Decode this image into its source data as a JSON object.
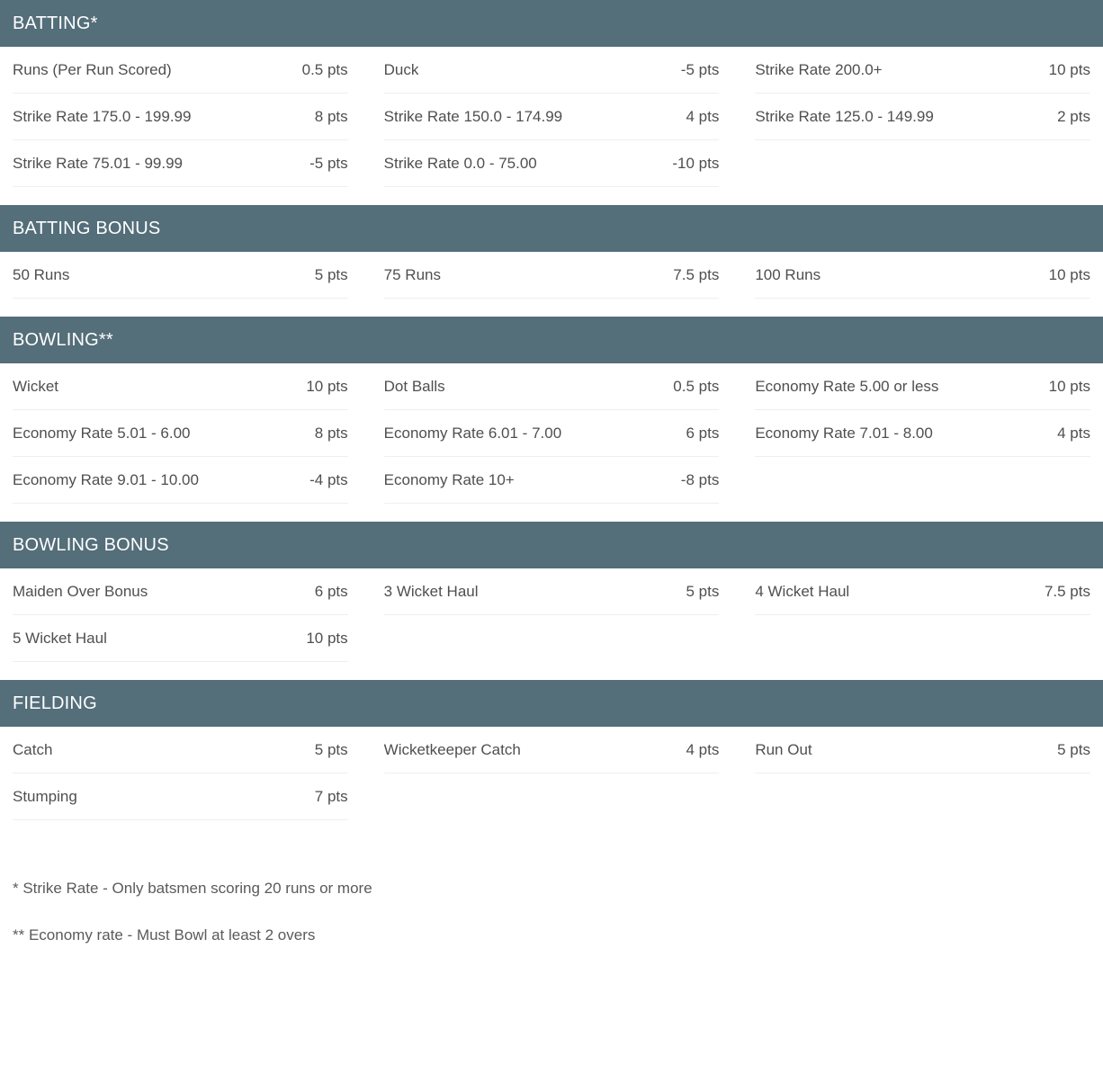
{
  "theme": {
    "header_bg": "#546e7a",
    "header_text": "#ffffff",
    "body_text": "#4f4f4f",
    "divider": "#eceff1",
    "page_bg": "#ffffff"
  },
  "sections": [
    {
      "id": "batting",
      "title": "BATTING*",
      "rows": [
        {
          "label": "Runs (Per Run Scored)",
          "value": "0.5 pts"
        },
        {
          "label": "Duck",
          "value": "-5 pts"
        },
        {
          "label": "Strike Rate 200.0+",
          "value": "10 pts"
        },
        {
          "label": "Strike Rate 175.0 - 199.99",
          "value": "8 pts"
        },
        {
          "label": "Strike Rate 150.0 - 174.99",
          "value": "4 pts"
        },
        {
          "label": "Strike Rate 125.0 - 149.99",
          "value": "2 pts"
        },
        {
          "label": "Strike Rate 75.01 - 99.99",
          "value": "-5 pts"
        },
        {
          "label": "Strike Rate 0.0 - 75.00",
          "value": "-10 pts"
        },
        {
          "label": "",
          "value": ""
        }
      ]
    },
    {
      "id": "batting-bonus",
      "title": "BATTING BONUS",
      "rows": [
        {
          "label": "50 Runs",
          "value": "5 pts"
        },
        {
          "label": "75 Runs",
          "value": "7.5 pts"
        },
        {
          "label": "100 Runs",
          "value": "10 pts"
        }
      ]
    },
    {
      "id": "bowling",
      "title": "BOWLING**",
      "rows": [
        {
          "label": "Wicket",
          "value": "10 pts"
        },
        {
          "label": "Dot Balls",
          "value": "0.5 pts"
        },
        {
          "label": "Economy Rate 5.00 or less",
          "value": "10 pts"
        },
        {
          "label": "Economy Rate 5.01 - 6.00",
          "value": "8 pts"
        },
        {
          "label": "Economy Rate 6.01 - 7.00",
          "value": "6 pts"
        },
        {
          "label": "Economy Rate 7.01 - 8.00",
          "value": "4 pts"
        },
        {
          "label": "Economy Rate 9.01 - 10.00",
          "value": "-4 pts"
        },
        {
          "label": "Economy Rate 10+",
          "value": "-8 pts"
        },
        {
          "label": "",
          "value": ""
        }
      ]
    },
    {
      "id": "bowling-bonus",
      "title": "BOWLING BONUS",
      "rows": [
        {
          "label": "Maiden Over Bonus",
          "value": "6 pts"
        },
        {
          "label": "3 Wicket Haul",
          "value": "5 pts"
        },
        {
          "label": "4 Wicket Haul",
          "value": "7.5 pts"
        },
        {
          "label": "5 Wicket Haul",
          "value": "10 pts"
        },
        {
          "label": "",
          "value": ""
        },
        {
          "label": "",
          "value": ""
        }
      ]
    },
    {
      "id": "fielding",
      "title": "FIELDING",
      "rows": [
        {
          "label": "Catch",
          "value": "5 pts"
        },
        {
          "label": "Wicketkeeper Catch",
          "value": "4 pts"
        },
        {
          "label": "Run Out",
          "value": "5 pts"
        },
        {
          "label": "Stumping",
          "value": "7 pts"
        },
        {
          "label": "",
          "value": ""
        },
        {
          "label": "",
          "value": ""
        }
      ]
    }
  ],
  "footnotes": [
    "* Strike Rate - Only batsmen scoring 20 runs or more",
    "** Economy rate - Must Bowl at least 2 overs"
  ]
}
